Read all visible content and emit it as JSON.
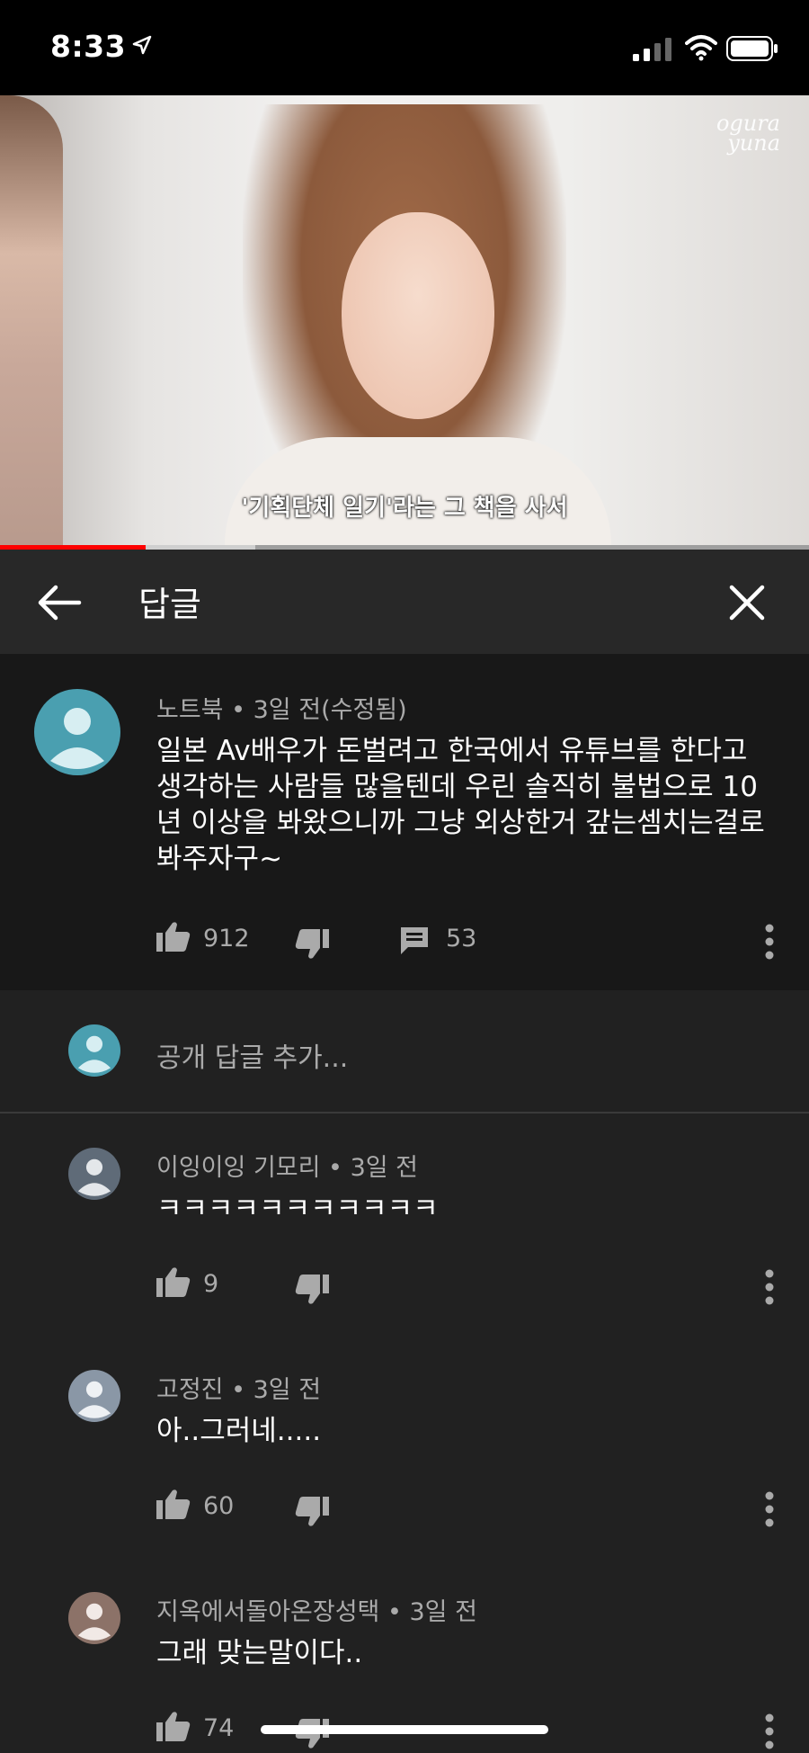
{
  "status_bar": {
    "time": "8:33"
  },
  "video": {
    "watermark_line1": "ogura",
    "watermark_line2": "yuna",
    "subtitle": "'기획단체 일기'라는 그 책을 사서",
    "progress_played": 0.18,
    "progress_buffered": 0.315
  },
  "header": {
    "title": "답글"
  },
  "main_comment": {
    "author": "노트북",
    "time": "3일 전(수정됨)",
    "text": "일본 Av배우가 돈벌려고 한국에서 유튜브를 한다고 생각하는 사람들 많을텐데 우린 솔직히 불법으로 10년 이상을 봐왔으니까 그냥 외상한거 갚는셈치는걸로 봐주자구~",
    "likes": "912",
    "replies": "53",
    "avatar_color": "#4a9fb0"
  },
  "add_reply": {
    "placeholder": "공개 답글 추가..."
  },
  "replies": [
    {
      "author": "이잉이잉 기모리",
      "time": "3일 전",
      "text": "ㅋㅋㅋㅋㅋㅋㅋㅋㅋㅋㅋ",
      "likes": "9",
      "avatar_color": "#5f6b78"
    },
    {
      "author": "고정진",
      "time": "3일 전",
      "text": "아..그러네.....",
      "likes": "60",
      "avatar_color": "#8a97a6"
    },
    {
      "author": "지옥에서돌아온장성택",
      "time": "3일 전",
      "text": "그래 맞는말이다..",
      "likes": "74",
      "avatar_color": "#8c7268"
    }
  ],
  "icons": [
    "location-arrow-icon",
    "signal-icon",
    "wifi-icon",
    "battery-icon",
    "back-arrow-icon",
    "close-icon",
    "thumb-up-icon",
    "thumb-down-icon",
    "comment-icon",
    "more-vert-icon",
    "avatar-icon"
  ]
}
